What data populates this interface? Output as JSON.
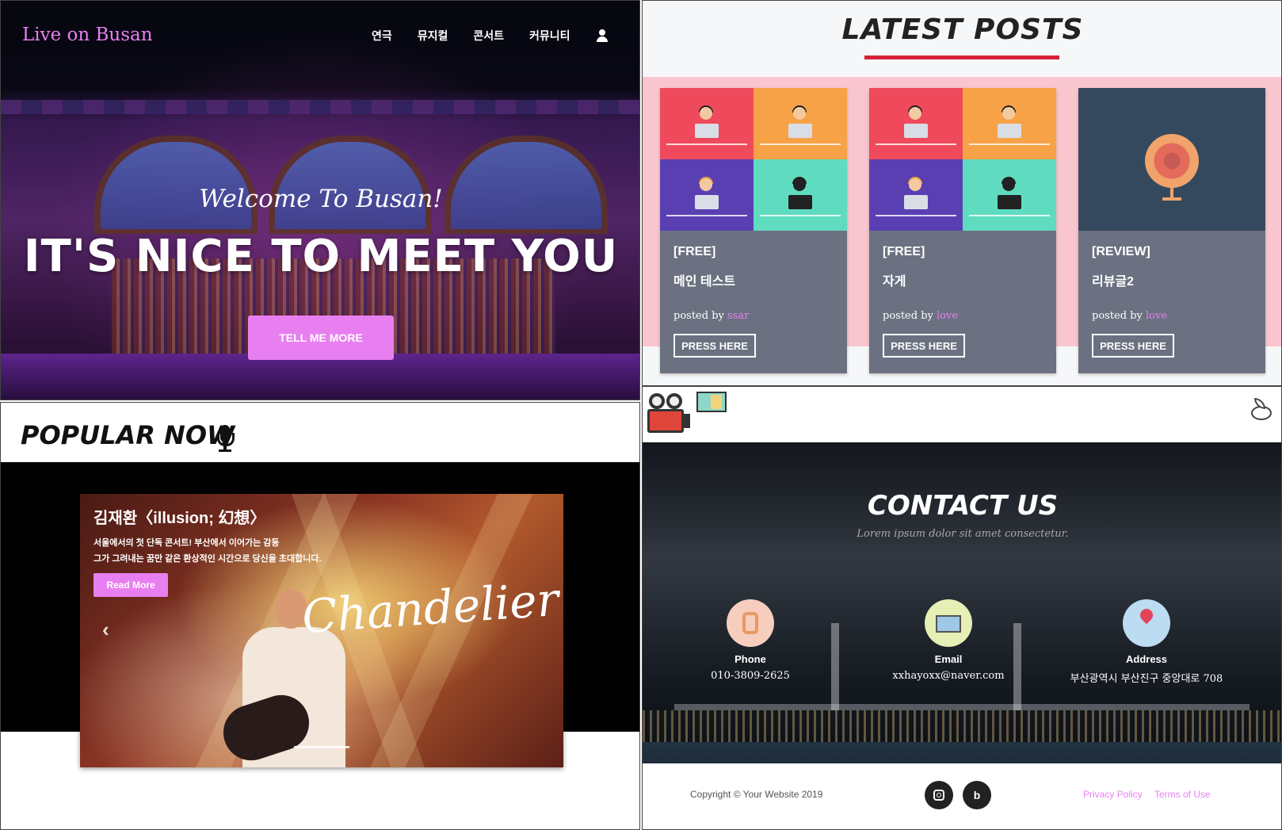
{
  "hero": {
    "brand": "Live on Busan",
    "nav": [
      "연극",
      "뮤지컬",
      "콘서트",
      "커뮤니티"
    ],
    "user_icon": "user-icon",
    "welcome": "Welcome To Busan!",
    "title": "IT'S NICE TO MEET YOU",
    "cta": "TELL ME MORE"
  },
  "posts": {
    "title": "LATEST POSTS",
    "accent": "#d6213a",
    "band_color": "#f9c6cf",
    "posted_by_label": "posted by",
    "button_label": "PRESS HERE",
    "items": [
      {
        "category": "[FREE]",
        "name": "메인 테스트",
        "author": "ssar",
        "image": "coders-grid"
      },
      {
        "category": "[FREE]",
        "name": "자게",
        "author": "love",
        "image": "coders-grid"
      },
      {
        "category": "[REVIEW]",
        "name": "리뷰글2",
        "author": "love",
        "image": "disc-icon"
      }
    ]
  },
  "popular": {
    "title": "POPULAR NOW",
    "icon": "mic-icon",
    "slide": {
      "title": "김재환〈illusion; 幻想〉",
      "desc_line1": "서울에서의 첫 단독 콘서트! 부산에서 이어가는 감동",
      "desc_line2": "그가 그려내는 꿈만 같은 환상적인 시간으로 당신을 초대합니다.",
      "button": "Read More",
      "script_text": "Chandelier"
    }
  },
  "contact": {
    "title": "CONTACT US",
    "subtitle": "Lorem ipsum dolor sit amet consectetur.",
    "items": [
      {
        "label": "Phone",
        "value": "010-3809-2625",
        "icon": "phone-icon"
      },
      {
        "label": "Email",
        "value": "xxhayoxx@naver.com",
        "icon": "email-icon"
      },
      {
        "label": "Address",
        "value": "부산광역시 부산진구 중앙대로 708",
        "icon": "address-icon"
      }
    ],
    "footer": {
      "copyright": "Copyright © Your Website 2019",
      "privacy": "Privacy Policy",
      "terms": "Terms of Use"
    }
  },
  "colors": {
    "brand_pink": "#e87ff0",
    "card_gray": "#6b7180"
  }
}
